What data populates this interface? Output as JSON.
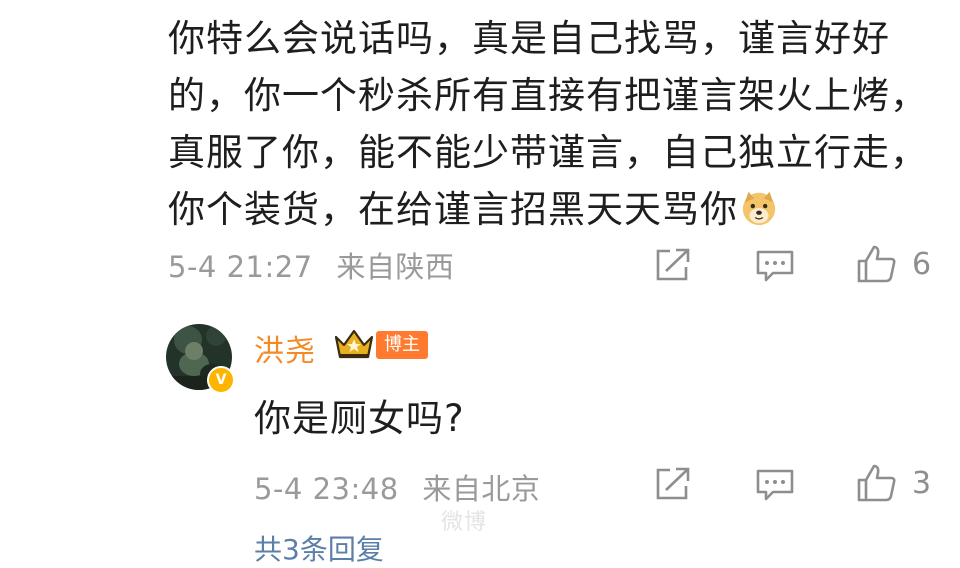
{
  "comment": {
    "lines": [
      "你特么会说话吗，真是自己找骂，谨言好好",
      "的，你一个秒杀所有直接有把谨言架火上烤，",
      "真服了你，能不能少带谨言，自己独立行走，",
      "你个装货，在给谨言招黑天天骂你"
    ],
    "emoji_icon": "doge-emoji",
    "date": "5-4 21:27",
    "location": "来自陕西",
    "like_count": "6"
  },
  "reply": {
    "username": "洪尧",
    "author_tag": "博主",
    "verified_badge": "V",
    "text": "你是厕女吗?",
    "date": "5-4 23:48",
    "location": "来自北京",
    "like_count": "3"
  },
  "footer": {
    "total_replies": "共3条回复",
    "watermark": "微博"
  },
  "icons": [
    "share-icon",
    "comment-icon",
    "like-icon",
    "crown-icon"
  ],
  "colors": {
    "username": "#f48a25",
    "author_tag_bg": "#ff7a2e",
    "meta_text": "#9a9a9a",
    "link": "#5c7fa8",
    "verified_badge": "#ffb400"
  }
}
